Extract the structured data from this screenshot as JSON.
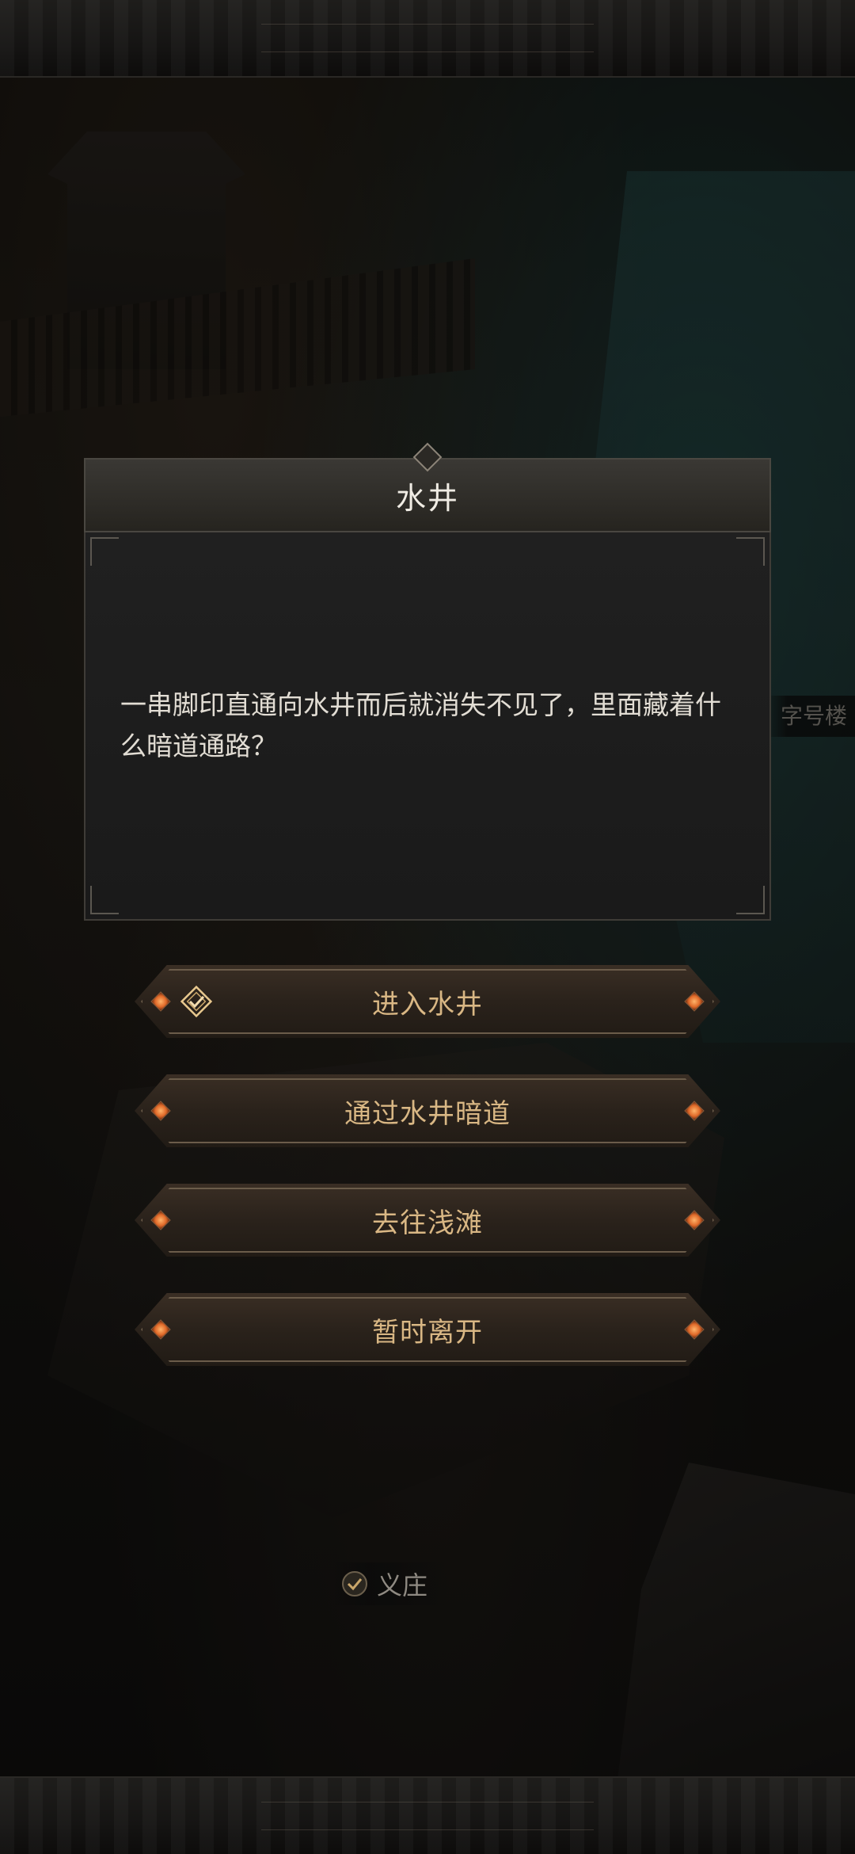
{
  "event": {
    "title": "水井",
    "description": "一串脚印直通向水井而后就消失不见了，里面藏着什么暗道通路？"
  },
  "options": [
    {
      "label": "进入水井",
      "selected": true
    },
    {
      "label": "通过水井暗道",
      "selected": false
    },
    {
      "label": "去往浅滩",
      "selected": false
    },
    {
      "label": "暂时离开",
      "selected": false
    }
  ],
  "map": {
    "side_label": "字号楼",
    "current_location": "义庄"
  },
  "colors": {
    "option_text": "#d9b784",
    "gem": "#e06a2a",
    "panel": "#1e1e1e"
  }
}
